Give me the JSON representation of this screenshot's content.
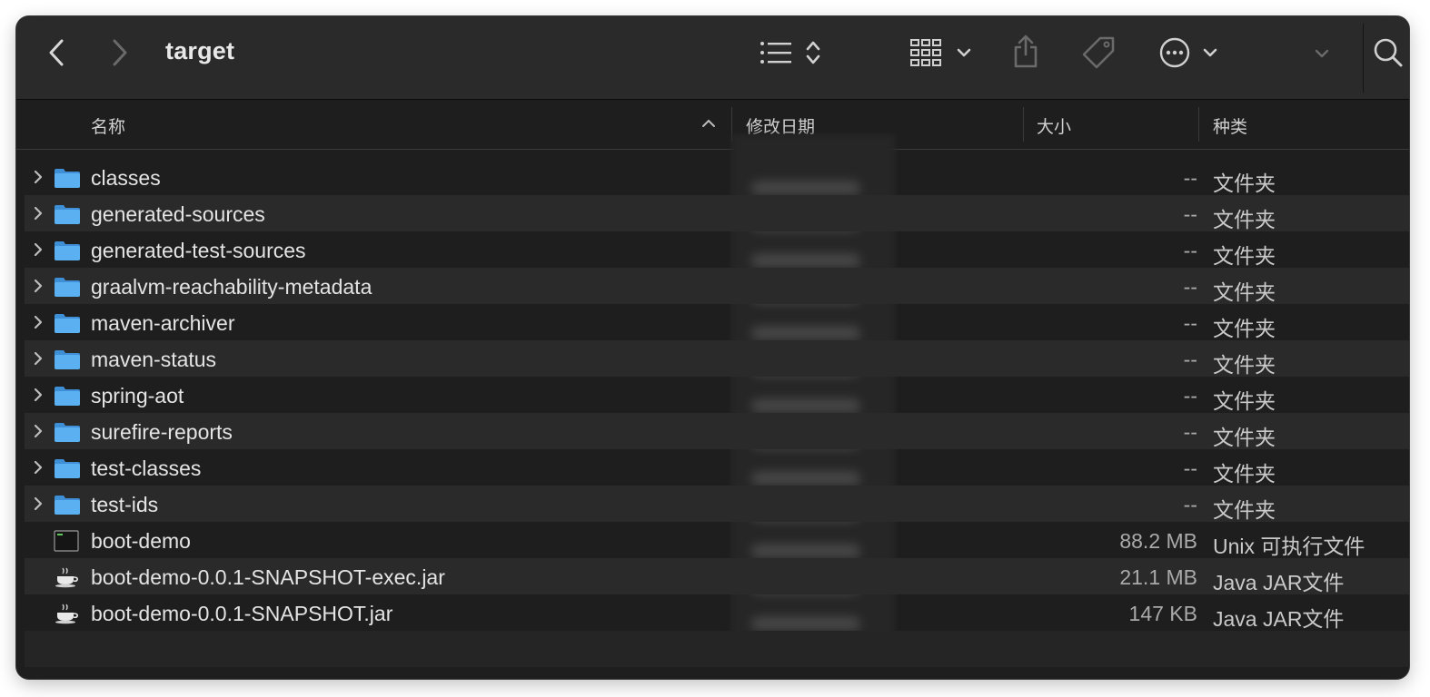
{
  "window": {
    "title": "target"
  },
  "toolbar": {
    "icons": [
      "back-icon",
      "forward-icon",
      "list-view-icon",
      "sort-icon",
      "grid-view-icon",
      "chevron-down-icon",
      "share-icon",
      "tag-icon",
      "more-icon",
      "chevron-down-icon",
      "search-icon"
    ]
  },
  "columns": {
    "name": "名称",
    "date": "修改日期",
    "size": "大小",
    "kind": "种类"
  },
  "files": [
    {
      "name": "classes",
      "size": "--",
      "kind": "文件夹",
      "type": "folder"
    },
    {
      "name": "generated-sources",
      "size": "--",
      "kind": "文件夹",
      "type": "folder"
    },
    {
      "name": "generated-test-sources",
      "size": "--",
      "kind": "文件夹",
      "type": "folder"
    },
    {
      "name": "graalvm-reachability-metadata",
      "size": "--",
      "kind": "文件夹",
      "type": "folder"
    },
    {
      "name": "maven-archiver",
      "size": "--",
      "kind": "文件夹",
      "type": "folder"
    },
    {
      "name": "maven-status",
      "size": "--",
      "kind": "文件夹",
      "type": "folder"
    },
    {
      "name": "spring-aot",
      "size": "--",
      "kind": "文件夹",
      "type": "folder"
    },
    {
      "name": "surefire-reports",
      "size": "--",
      "kind": "文件夹",
      "type": "folder"
    },
    {
      "name": "test-classes",
      "size": "--",
      "kind": "文件夹",
      "type": "folder"
    },
    {
      "name": "test-ids",
      "size": "--",
      "kind": "文件夹",
      "type": "folder"
    },
    {
      "name": "boot-demo",
      "size": "88.2 MB",
      "kind": "Unix 可执行文件",
      "type": "exec"
    },
    {
      "name": "boot-demo-0.0.1-SNAPSHOT-exec.jar",
      "size": "21.1 MB",
      "kind": "Java JAR文件",
      "type": "jar"
    },
    {
      "name": "boot-demo-0.0.1-SNAPSHOT.jar",
      "size": "147 KB",
      "kind": "Java JAR文件",
      "type": "jar"
    }
  ],
  "colors": {
    "folder": "#5ab0f0",
    "background": "#1e1e1e",
    "toolbar": "#2a2a2a"
  }
}
